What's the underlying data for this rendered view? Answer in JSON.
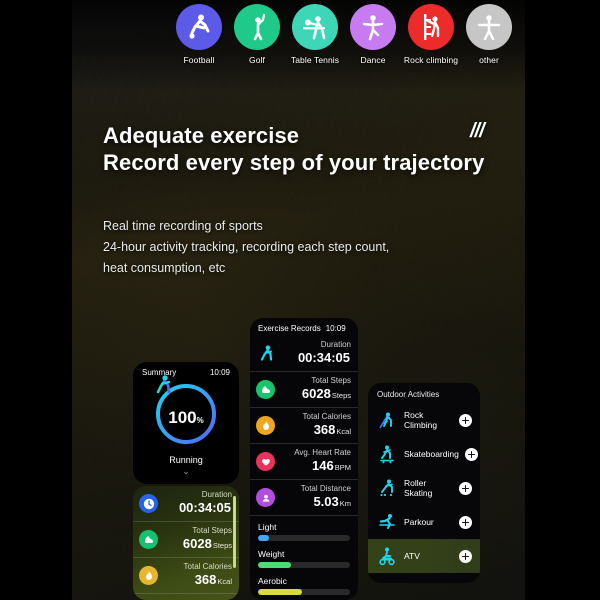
{
  "sports": [
    {
      "label": "Football",
      "icon": "football-icon",
      "color": "#5B5BE8"
    },
    {
      "label": "Golf",
      "icon": "golf-icon",
      "color": "#1EC98A"
    },
    {
      "label": "Table Tennis",
      "icon": "table-tennis-icon",
      "color": "#3ED6B6"
    },
    {
      "label": "Dance",
      "icon": "dance-icon",
      "color": "#C77BF0"
    },
    {
      "label": "Rock climbing",
      "icon": "rock-climbing-icon",
      "color": "#ED2B2B"
    },
    {
      "label": "other",
      "icon": "other-person-icon",
      "color": "#C6C6C6"
    }
  ],
  "hero": {
    "headline_line1": "Adequate exercise",
    "headline_line2": "Record every step of your trajectory",
    "accent_mark": "///",
    "sub_line1": "Real time recording of sports",
    "sub_line2": "24-hour activity tracking, recording each step count,",
    "sub_line3": "heat consumption, etc"
  },
  "summary": {
    "title": "Summary",
    "time": "10:09",
    "percent": "100",
    "percent_unit": "%",
    "activity": "Running",
    "chevron": "⌄",
    "ring_color_start": "#22D3EE",
    "ring_color_end": "#4F6BF5",
    "runner_icon": "running-person-icon"
  },
  "green_card": {
    "metrics": [
      {
        "icon": "clock-icon",
        "color": "#2563EB",
        "label": "Duration",
        "value": "00:34:05",
        "unit": ""
      },
      {
        "icon": "shoe-icon",
        "color": "#16C172",
        "label": "Total Steps",
        "value": "6028",
        "unit": "Steps"
      },
      {
        "icon": "flame-icon",
        "color": "#E8B62C",
        "label": "Total Calories",
        "value": "368",
        "unit": "Kcal"
      }
    ]
  },
  "records": {
    "title": "Exercise Records",
    "time": "10:09",
    "runner_icon": "running-person-icon",
    "metrics": [
      {
        "icon": "running-person-icon",
        "color": "transparent",
        "label": "Duration",
        "value": "00:34:05",
        "unit": ""
      },
      {
        "icon": "shoe-icon",
        "color": "#19C56B",
        "label": "Total Steps",
        "value": "6028",
        "unit": "Steps"
      },
      {
        "icon": "flame-icon",
        "color": "#F0A51E",
        "label": "Total Calories",
        "value": "368",
        "unit": "Kcal"
      },
      {
        "icon": "heart-icon",
        "color": "#E8345C",
        "label": "Avg. Heart Rate",
        "value": "146",
        "unit": "BPM"
      },
      {
        "icon": "location-pin-icon",
        "color": "#B44CE0",
        "label": "Total Distance",
        "value": "5.03",
        "unit": "Km"
      }
    ],
    "sliders": [
      {
        "label": "Light",
        "fill": 12,
        "color": "#3FA9F5"
      },
      {
        "label": "Weight",
        "fill": 36,
        "color": "#4BDE6E"
      },
      {
        "label": "Aerobic",
        "fill": 48,
        "color": "#D6DB3F"
      }
    ]
  },
  "outdoor": {
    "title": "Outdoor Activities",
    "activities": [
      {
        "label": "Rock Climbing",
        "icon": "rock-climbing-icon",
        "action": "add-button"
      },
      {
        "label": "Skateboarding",
        "icon": "skateboarding-icon",
        "action": "add-button"
      },
      {
        "label": "Roller Skating",
        "icon": "roller-skating-icon",
        "action": "add-button"
      },
      {
        "label": "Parkour",
        "icon": "parkour-icon",
        "action": "add-button"
      },
      {
        "label": "ATV",
        "icon": "atv-icon",
        "action": "add-button"
      }
    ]
  }
}
